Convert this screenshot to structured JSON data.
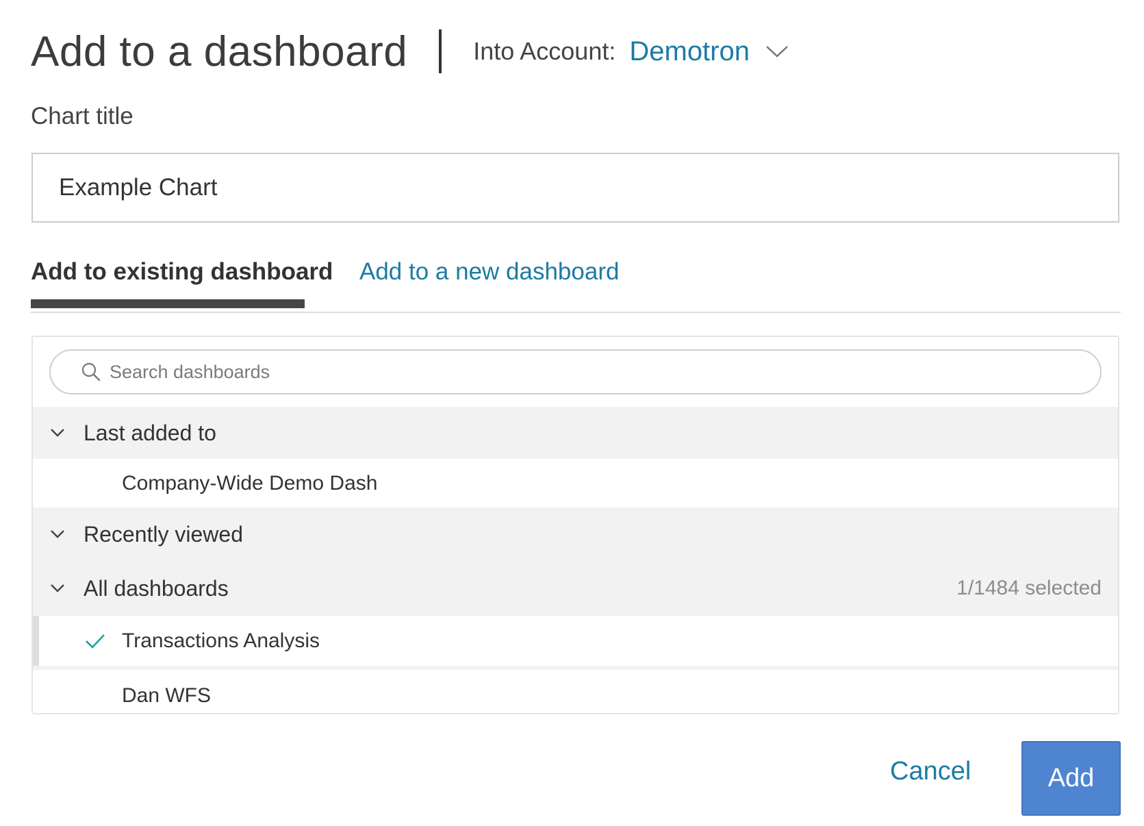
{
  "dialog": {
    "title": "Add to a dashboard",
    "account_label": "Into Account:",
    "account_value": "Demotron"
  },
  "chart_title": {
    "label": "Chart title",
    "value": "Example Chart"
  },
  "tabs": {
    "existing": "Add to existing dashboard",
    "new": "Add to a new dashboard",
    "active": "existing"
  },
  "search": {
    "placeholder": "Search dashboards",
    "value": ""
  },
  "sections": [
    {
      "label": "Last added to",
      "expanded": true,
      "items": [
        {
          "label": "Company-Wide Demo Dash",
          "selected": false
        }
      ]
    },
    {
      "label": "Recently viewed",
      "expanded": true,
      "items": []
    },
    {
      "label": "All dashboards",
      "expanded": true,
      "count": "1/1484 selected",
      "items": [
        {
          "label": "Transactions Analysis",
          "selected": true
        },
        {
          "label": "Dan WFS",
          "selected": false
        }
      ]
    }
  ],
  "footer": {
    "cancel_label": "Cancel",
    "add_label": "Add"
  },
  "colors": {
    "accent_link": "#1d7aa3",
    "primary_button": "#4f85d0",
    "check": "#1aa39a",
    "section_bg": "#f2f2f2"
  },
  "icons": {
    "account_dropdown": "chevron-down-icon",
    "search": "search-icon",
    "section_toggle": "chevron-down-icon",
    "selected": "check-icon"
  }
}
